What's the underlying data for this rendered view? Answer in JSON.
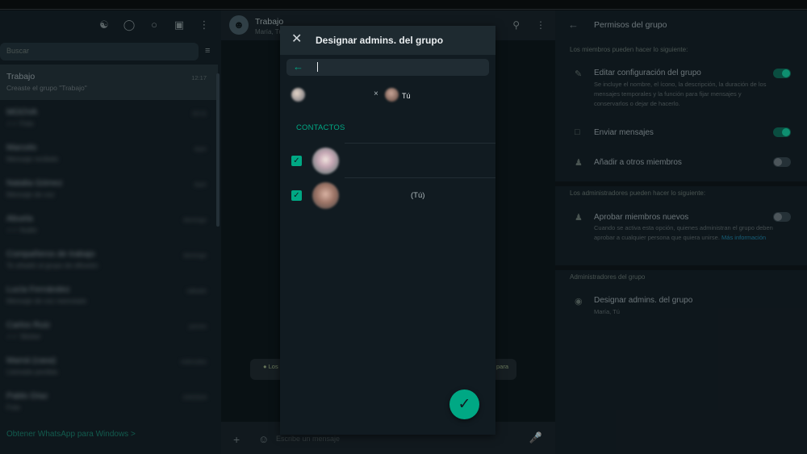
{
  "left": {
    "search_placeholder": "Buscar",
    "chats": [
      {
        "name": "Trabajo",
        "preview": "Creaste el grupo \"Trabajo\"",
        "time": "12:17",
        "blur": false,
        "active": true
      },
      {
        "name": "MOOVA",
        "preview": "✓✓ Foto",
        "time": "10:11",
        "blur": true,
        "active": false
      },
      {
        "name": "Marcelo",
        "preview": "Mensaje recibido",
        "time": "Ayer",
        "blur": true,
        "active": false
      },
      {
        "name": "Natalia Gómez",
        "preview": "Mensaje de voz",
        "time": "Ayer",
        "blur": true,
        "active": false
      },
      {
        "name": "Abuela",
        "preview": "✓✓ Audio",
        "time": "domingo",
        "blur": true,
        "active": false
      },
      {
        "name": "Compañeros de trabajo",
        "preview": "Te añadió al grupo de difusión",
        "time": "domingo",
        "blur": true,
        "active": false
      },
      {
        "name": "Lucía Fernández",
        "preview": "Mensaje de voz reenviado",
        "time": "sábado",
        "blur": true,
        "active": false
      },
      {
        "name": "Carlos Ruiz",
        "preview": "✓✓ Sticker",
        "time": "jueves",
        "blur": true,
        "active": false
      },
      {
        "name": "Mamá (casa)",
        "preview": "Llamada perdida",
        "time": "miércoles",
        "blur": true,
        "active": false
      },
      {
        "name": "Pablo Díaz",
        "preview": "Foto",
        "time": "2/4/2024",
        "blur": true,
        "active": false
      }
    ],
    "get_app": "Obtener WhatsApp para Windows  >"
  },
  "middle": {
    "title": "Trabajo",
    "subtitle": "María, Tú",
    "system_msg_a": "● Los",
    "system_msg_b": "para",
    "composer_placeholder": "Escribe un mensaje"
  },
  "right": {
    "title": "Permisos del grupo",
    "members_can": "Los miembros pueden hacer lo siguiente:",
    "edit_title": "Editar configuración del grupo",
    "edit_desc": "Se incluye el nombre, el ícono, la descripción, la duración de los mensajes temporales y la función para fijar mensajes y conservarlos o dejar de hacerlo.",
    "send_title": "Enviar mensajes",
    "add_title": "Añadir a otros miembros",
    "admins_can": "Los administradores pueden hacer lo siguiente:",
    "approve_title": "Aprobar miembros nuevos",
    "approve_desc": "Cuando se activa esta opción, quienes administran el grupo deben aprobar a cualquier persona que quiera unirse.",
    "approve_link": "Más información",
    "group_admins": "Administradores del grupo",
    "designate_title": "Designar admins. del grupo",
    "designate_sub": "María, Tú"
  },
  "dialog": {
    "title": "Designar admins. del grupo",
    "search_value": "",
    "chip_x": "×",
    "chip_you": "Tú",
    "section": "CONTACTOS",
    "rows": [
      {
        "label": "",
        "checked": true
      },
      {
        "label": "(Tú)",
        "checked": true
      }
    ],
    "confirm_icon": "check-icon"
  },
  "colors": {
    "accent": "#00a884",
    "panel": "#111b21",
    "header": "#1e2a30"
  }
}
